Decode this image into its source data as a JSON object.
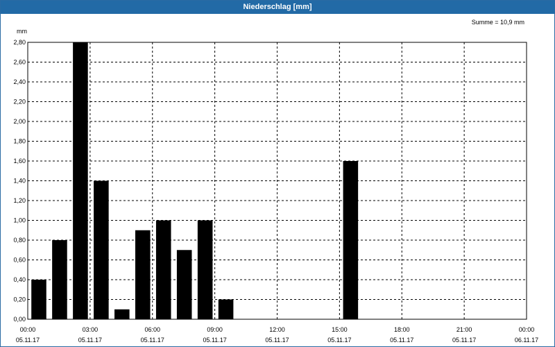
{
  "window": {
    "title": "Niederschlag [mm]"
  },
  "chart_data": {
    "type": "bar",
    "title": "Niederschlag [mm]",
    "ylabel": "mm",
    "annotation": "Summe = 10,9 mm",
    "ylim": [
      0,
      2.8
    ],
    "yticks": [
      "0,00",
      "0,20",
      "0,40",
      "0,60",
      "0,80",
      "1,00",
      "1,20",
      "1,40",
      "1,60",
      "1,80",
      "2,00",
      "2,20",
      "2,40",
      "2,60",
      "2,80"
    ],
    "xlim_hours": [
      0,
      24
    ],
    "xticks": [
      {
        "time": "00:00",
        "date": "05.11.17"
      },
      {
        "time": "03:00",
        "date": "05.11.17"
      },
      {
        "time": "06:00",
        "date": "05.11.17"
      },
      {
        "time": "09:00",
        "date": "05.11.17"
      },
      {
        "time": "12:00",
        "date": "05.11.17"
      },
      {
        "time": "15:00",
        "date": "05.11.17"
      },
      {
        "time": "18:00",
        "date": "05.11.17"
      },
      {
        "time": "21:00",
        "date": "05.11.17"
      },
      {
        "time": "00:00",
        "date": "06.11.17"
      }
    ],
    "bars": [
      {
        "hour": 0,
        "value": 0.4
      },
      {
        "hour": 1,
        "value": 0.8
      },
      {
        "hour": 2,
        "value": 2.8
      },
      {
        "hour": 3,
        "value": 1.4
      },
      {
        "hour": 4,
        "value": 0.1
      },
      {
        "hour": 5,
        "value": 0.9
      },
      {
        "hour": 6,
        "value": 1.0
      },
      {
        "hour": 7,
        "value": 0.7
      },
      {
        "hour": 8,
        "value": 1.0
      },
      {
        "hour": 9,
        "value": 0.2
      },
      {
        "hour": 15,
        "value": 1.6
      }
    ],
    "bar_color": "#000000",
    "grid": true
  }
}
